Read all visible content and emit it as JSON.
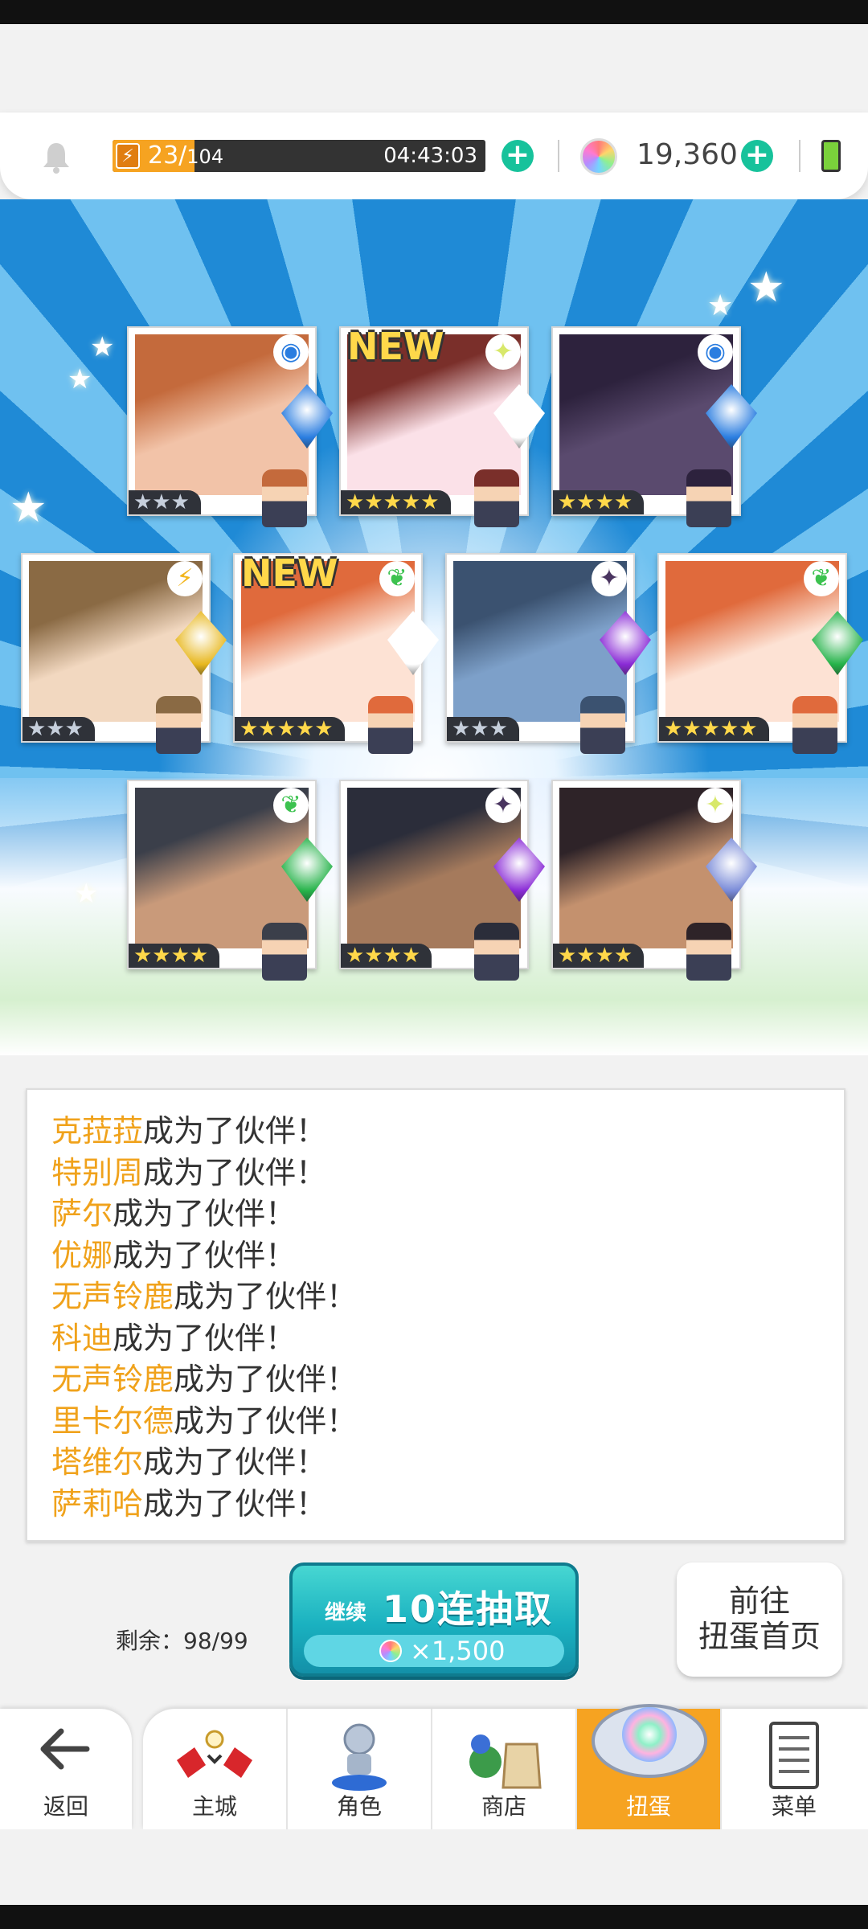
{
  "header": {
    "stamina_current": "23/",
    "stamina_max": "104",
    "stamina_fill_ratio": 0.22,
    "stamina_timer": "04:43:03",
    "gem_count": "19,360"
  },
  "cards": [
    {
      "stars": "★★★",
      "rarity": 3,
      "new": false,
      "badge": "circle",
      "crystal_color": "#2a7de0"
    },
    {
      "stars": "★★★★★",
      "rarity": 5,
      "new": true,
      "badge": "sparkle",
      "crystal_color": "#ffffff"
    },
    {
      "stars": "★★★★",
      "rarity": 4,
      "new": false,
      "badge": "circle",
      "crystal_color": "#2a7de0"
    },
    {
      "stars": "★★★",
      "rarity": 3,
      "new": false,
      "badge": "bolt",
      "crystal_color": "#e8b820"
    },
    {
      "stars": "★★★★★",
      "rarity": 5,
      "new": true,
      "badge": "leaf",
      "crystal_color": "#ffffff"
    },
    {
      "stars": "★★★",
      "rarity": 3,
      "new": false,
      "badge": "dark-star",
      "crystal_color": "#8a2bd6"
    },
    {
      "stars": "★★★★★",
      "rarity": 5,
      "new": false,
      "badge": "leaf",
      "crystal_color": "#26b34a"
    },
    {
      "stars": "★★★★",
      "rarity": 4,
      "new": false,
      "badge": "leaf",
      "crystal_color": "#26b34a"
    },
    {
      "stars": "★★★★",
      "rarity": 4,
      "new": false,
      "badge": "dark-star",
      "crystal_color": "#8a2bd6"
    },
    {
      "stars": "★★★★",
      "rarity": 4,
      "new": false,
      "badge": "sparkle",
      "crystal_color": "#7a8bd8"
    }
  ],
  "new_label": "NEW",
  "log": [
    {
      "name": "克菈菈",
      "text": "成为了伙伴！"
    },
    {
      "name": "特别周",
      "text": "成为了伙伴！"
    },
    {
      "name": "萨尔",
      "text": "成为了伙伴！"
    },
    {
      "name": "优娜",
      "text": "成为了伙伴！"
    },
    {
      "name": "无声铃鹿",
      "text": "成为了伙伴！"
    },
    {
      "name": "科迪",
      "text": "成为了伙伴！"
    },
    {
      "name": "无声铃鹿",
      "text": "成为了伙伴！"
    },
    {
      "name": "里卡尔德",
      "text": "成为了伙伴！"
    },
    {
      "name": "塔维尔",
      "text": "成为了伙伴！"
    },
    {
      "name": "萨莉哈",
      "text": "成为了伙伴！"
    }
  ],
  "remaining": "剩余：98/99",
  "pull_button": {
    "continue": "继续",
    "label": "10连抽取",
    "cost": "×1,500"
  },
  "home_button": {
    "line1": "前往",
    "line2": "扭蛋首页"
  },
  "tabs": {
    "back": "返回",
    "items": [
      {
        "label": "主城",
        "icon": "castle-icon"
      },
      {
        "label": "角色",
        "icon": "character-icon"
      },
      {
        "label": "商店",
        "icon": "shop-icon"
      },
      {
        "label": "扭蛋",
        "icon": "gacha-icon",
        "active": true
      },
      {
        "label": "菜单",
        "icon": "menu-icon"
      }
    ]
  },
  "colors": {
    "accent_orange": "#f6a321",
    "accent_teal": "#17c29b",
    "name_orange": "#f0a21b"
  }
}
